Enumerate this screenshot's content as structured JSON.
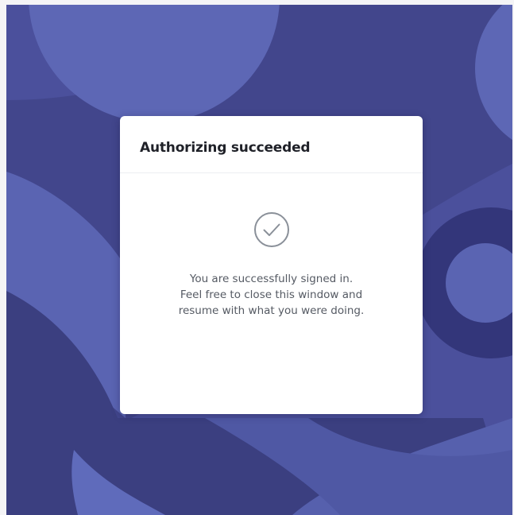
{
  "dialog": {
    "title": "Authorizing succeeded",
    "status_icon": "check-circle-icon",
    "message_lines": [
      "You are successfully signed in.",
      "Feel free to close this window and",
      "resume with what you were doing."
    ]
  },
  "colors": {
    "background": "#4b509c",
    "background_dark": "#3a3d7e",
    "background_light": "#5c68b8",
    "card": "#ffffff",
    "title_text": "#1f2128",
    "body_text": "#555a63",
    "icon_stroke": "#8a9099"
  }
}
